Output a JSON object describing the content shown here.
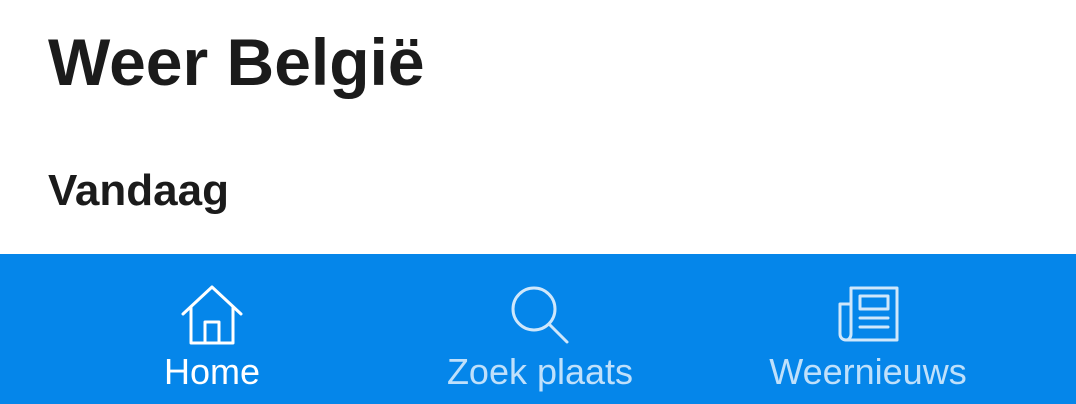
{
  "header": {
    "title": "Weer België"
  },
  "main": {
    "section_title": "Vandaag"
  },
  "bottom_nav": {
    "background_color": "#0586ea",
    "items": [
      {
        "label": "Home",
        "icon": "home-icon",
        "active": true
      },
      {
        "label": "Zoek plaats",
        "icon": "search-icon",
        "active": false
      },
      {
        "label": "Weernieuws",
        "icon": "newspaper-icon",
        "active": false
      }
    ]
  }
}
